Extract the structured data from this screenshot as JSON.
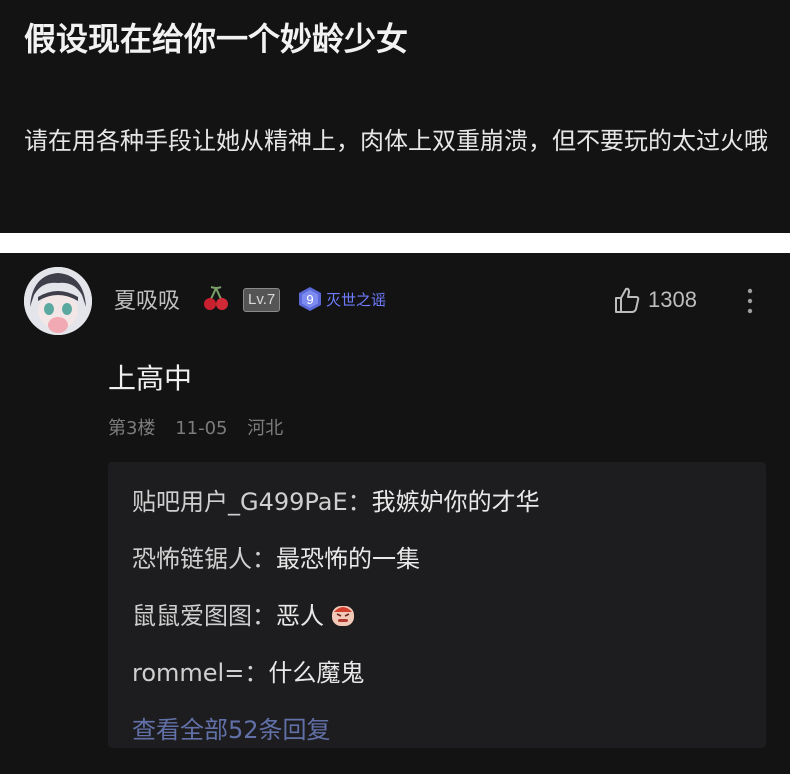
{
  "post": {
    "title": "假设现在给你一个妙龄少女",
    "body": "请在用各种手段让她从精神上，肉体上双重崩溃，但不要玩的太过火哦"
  },
  "comment": {
    "username": "夏吸吸",
    "level": "Lv.7",
    "title_badge": {
      "number": "9",
      "text": "灭世之谣"
    },
    "likes": "1308",
    "text": "上高中",
    "floor": "第3楼",
    "date": "11-05",
    "location": "河北",
    "replies": [
      {
        "author": "贴吧用户_G499PaE",
        "sep": "：",
        "content": "我嫉妒你的才华"
      },
      {
        "author": "恐怖链锯人",
        "sep": "：",
        "content": "最恐怖的一集"
      },
      {
        "author": "鼠鼠爱图图",
        "sep": "：",
        "content": "恶人"
      },
      {
        "author": "rommel=",
        "sep": "：",
        "content": "什么魔鬼"
      }
    ],
    "view_all": "查看全部52条回复"
  },
  "icons": [
    "avatar",
    "cherry-icon",
    "gem-badge-icon",
    "thumb-up-icon",
    "more-vertical-icon",
    "angry-emoji-icon"
  ],
  "colors": {
    "background": "#131314",
    "reply_box": "#1d1d1f",
    "link": "#6270a8",
    "badge_text": "#6f7cff"
  }
}
